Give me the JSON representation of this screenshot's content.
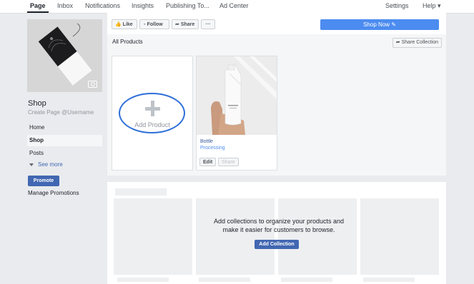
{
  "nav": {
    "tabs": [
      {
        "label": "Page"
      },
      {
        "label": "Inbox"
      },
      {
        "label": "Notifications"
      },
      {
        "label": "Insights"
      },
      {
        "label": "Publishing To..."
      },
      {
        "label": "Ad Center"
      },
      {
        "label": "Settings"
      },
      {
        "label": "Help ▾"
      }
    ]
  },
  "sidebar": {
    "page_name": "Shop",
    "username_link": "Create Page @Username",
    "items": [
      {
        "label": "Home"
      },
      {
        "label": "Shop"
      },
      {
        "label": "Posts"
      }
    ],
    "see_more": "See more",
    "promote": "Promote",
    "manage_promotions": "Manage Promotions"
  },
  "actions": {
    "like": "Like",
    "follow": "Follow",
    "share": "Share",
    "more": "···",
    "shop_now": "Shop Now ✎"
  },
  "products": {
    "title": "All Products",
    "share_collection": "Share Collection",
    "add_product": "Add Product",
    "items": [
      {
        "name": "Bottle",
        "status": "Processing",
        "edit": "Edit",
        "share": "Share"
      }
    ]
  },
  "collections": {
    "message_line1": "Add collections to organize your products and",
    "message_line2": "make it easier for customers to browse.",
    "add_button": "Add Collection"
  },
  "colors": {
    "primary_blue": "#4267b2",
    "shop_now_blue": "#4c8cf0",
    "highlight_ellipse": "#2e6fd8",
    "page_bg": "#e9ebee"
  }
}
